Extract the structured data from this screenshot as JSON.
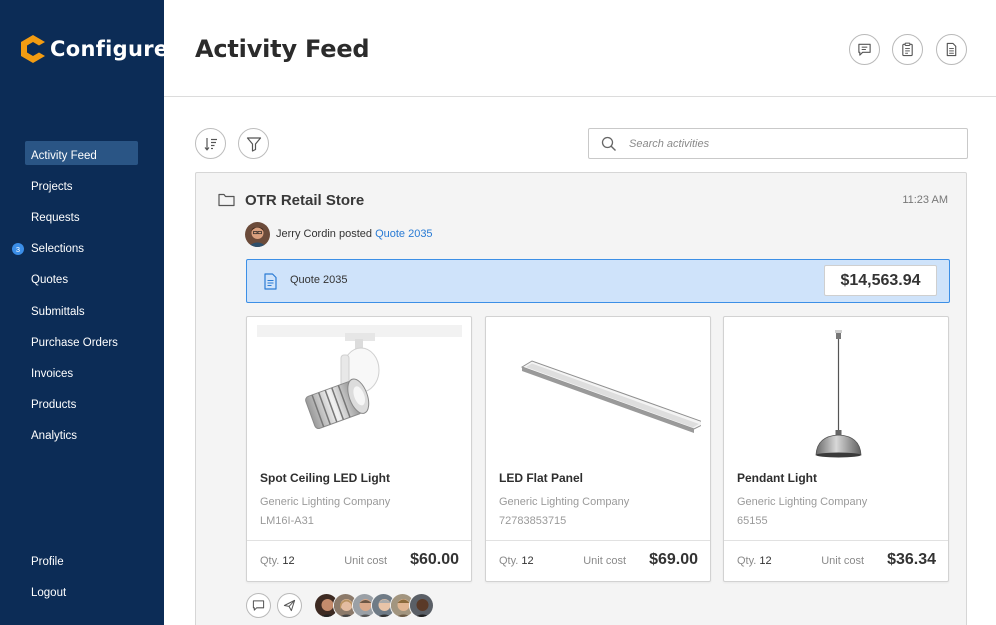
{
  "app": {
    "name": "Configure",
    "brand_color": "#0c2c56",
    "accent_color": "#f39c12"
  },
  "sidebar": {
    "items": [
      {
        "label": "Activity Feed",
        "active": true
      },
      {
        "label": "Projects"
      },
      {
        "label": "Requests"
      },
      {
        "label": "Selections",
        "badge": "3"
      },
      {
        "label": "Quotes"
      },
      {
        "label": "Submittals"
      },
      {
        "label": "Purchase Orders"
      },
      {
        "label": "Invoices"
      },
      {
        "label": "Products"
      },
      {
        "label": "Analytics"
      }
    ],
    "bottom_items": [
      {
        "label": "Profile"
      },
      {
        "label": "Logout"
      }
    ]
  },
  "header": {
    "title": "Activity Feed",
    "actions": [
      "chat-icon",
      "clipboard-icon",
      "document-icon"
    ]
  },
  "toolbar": {
    "sort_icon": "sort-icon",
    "filter_icon": "filter-icon",
    "search_placeholder": "Search activities"
  },
  "activity": {
    "project": "OTR Retail Store",
    "time": "11:23 AM",
    "user": "Jerry Cordin",
    "action": "posted",
    "link_text": "Quote 2035",
    "quote": {
      "label": "Quote 2035",
      "amount": "$14,563.94"
    },
    "products": [
      {
        "name": "Spot Ceiling LED Light",
        "company": "Generic Lighting Company",
        "sku": "LM16I-A31",
        "qty_label": "Qty.",
        "qty": "12",
        "unit_label": "Unit cost",
        "price": "$60.00"
      },
      {
        "name": "LED Flat Panel",
        "company": "Generic Lighting Company",
        "sku": "72783853715",
        "qty_label": "Qty.",
        "qty": "12",
        "unit_label": "Unit cost",
        "price": "$69.00"
      },
      {
        "name": "Pendant Light",
        "company": "Generic Lighting Company",
        "sku": "65155",
        "qty_label": "Qty.",
        "qty": "12",
        "unit_label": "Unit cost",
        "price": "$36.34"
      }
    ],
    "footer_actions": [
      "comment-icon",
      "send-icon"
    ],
    "participants": 6
  }
}
